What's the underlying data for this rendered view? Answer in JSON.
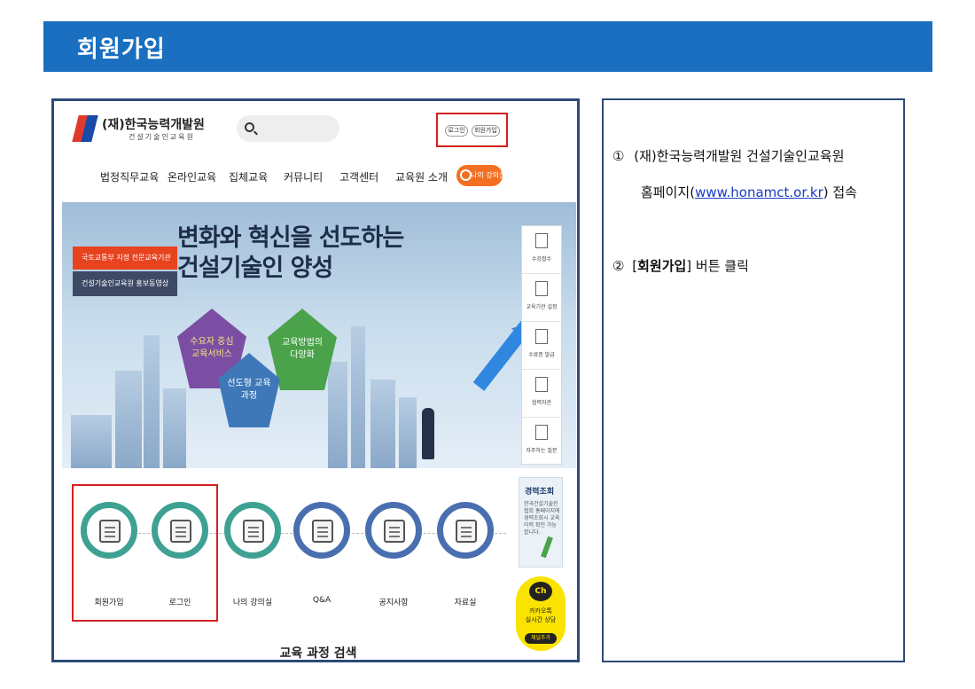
{
  "header": {
    "title": "회원가입"
  },
  "site": {
    "logo_name": "(재)한국능력개발원",
    "logo_sub": "건설기술인교육원",
    "auth": {
      "login": "로그인",
      "signup": "회원가입"
    },
    "nav": [
      "법정직무교육",
      "온라인교육",
      "집체교육",
      "커뮤니티",
      "고객센터",
      "교육원 소개"
    ],
    "my_room": "나의 강의실",
    "banner": {
      "headline_line1": "변화와 혁신을 선도하는",
      "headline_line2": "건설기술인 양성",
      "tag_red": "국토교통부 지정 전문교육기관",
      "tag_dark": "건설기술인교육원 홍보동영상",
      "pentagons": [
        "수요자 중심 교육서비스",
        "선도형 교육과정",
        "교육방법의 다양화"
      ]
    },
    "quick_panel": [
      "수강접수",
      "교육기관 설정",
      "수료증 발급",
      "협력자관",
      "자주하는 질문"
    ],
    "quick_links": [
      "회원가입",
      "로그인",
      "나의 강의실",
      "Q&A",
      "공지사항",
      "자료실"
    ],
    "career_card": {
      "title": "경력조회",
      "desc": "한국건설기술인협회 홈페이지에 경력조회시 교육이력 확인 가능합니다."
    },
    "kakao": {
      "badge": "Ch",
      "line1": "카카오톡",
      "line2": "실시간 상담",
      "button": "채널추가"
    },
    "course_search_title": "교육 과정 검색"
  },
  "instructions": {
    "step1_num": "①",
    "step1_line1": "(재)한국능력개발원 건설기술인교육원",
    "step1_line2_prefix": "홈페이지(",
    "step1_link": "www.honamct.or.kr",
    "step1_line2_suffix": ") 접속",
    "step2_num": "②",
    "step2_prefix": "[",
    "step2_bold": "회원가입",
    "step2_suffix": "] 버튼 클릭"
  },
  "colors": {
    "header_bg": "#1a6fc0",
    "highlight": "#d42020",
    "frame": "#2d4a79",
    "teal": "#3ea193",
    "blue": "#4a6fb0",
    "orange": "#f36f21"
  }
}
